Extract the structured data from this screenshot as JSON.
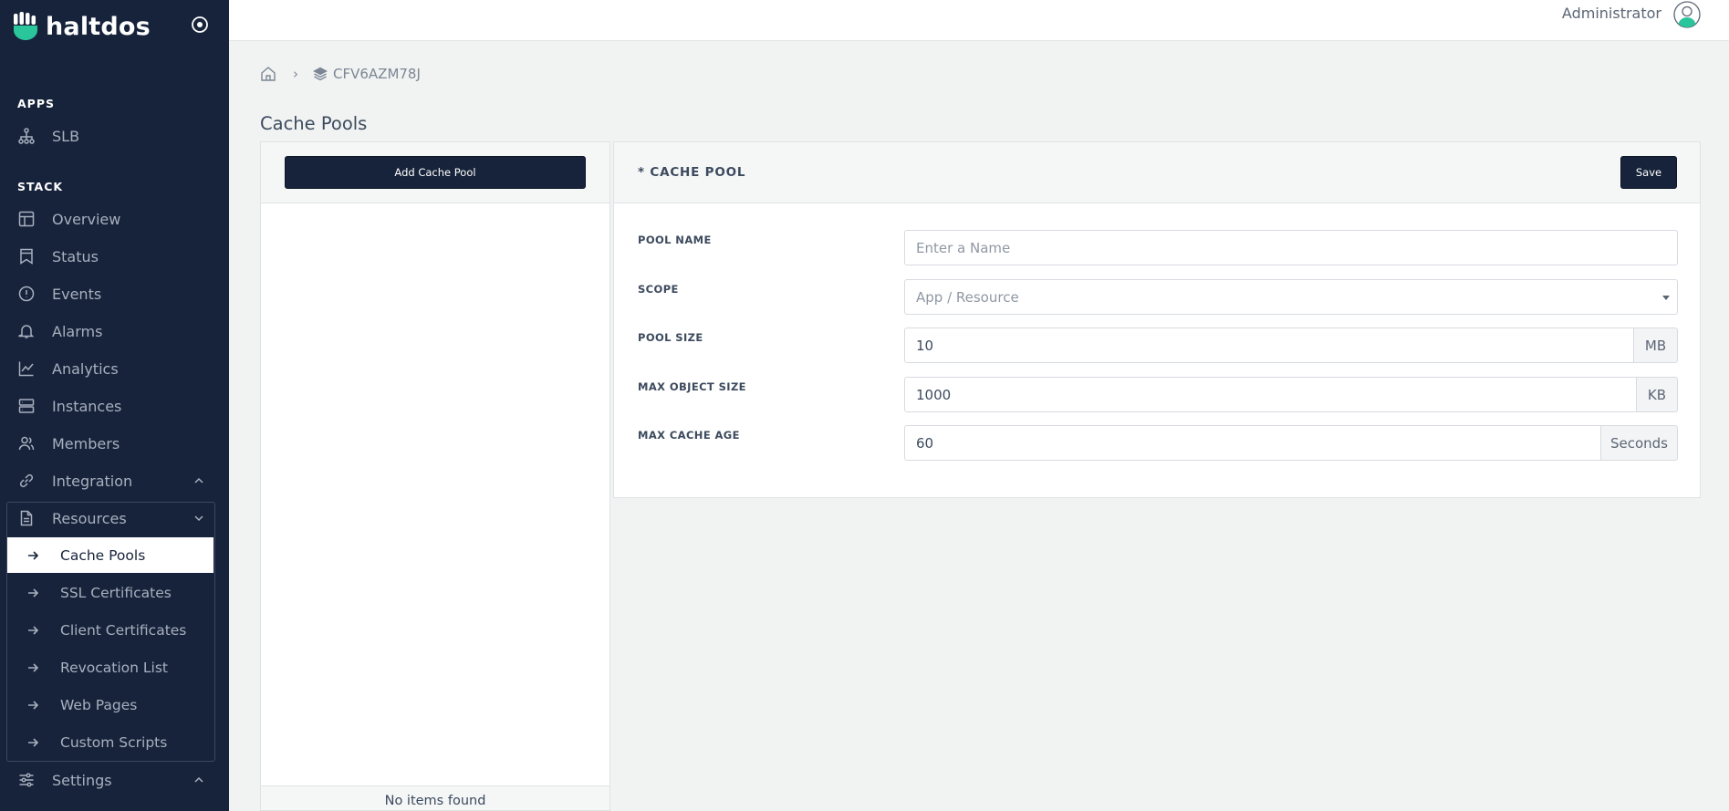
{
  "app": {
    "brand": "haltdos"
  },
  "sidebar": {
    "sections": {
      "apps": "APPS",
      "stack": "STACK"
    },
    "apps_items": [
      {
        "label": "SLB",
        "icon": "sitemap-icon"
      }
    ],
    "stack_items": [
      {
        "label": "Overview",
        "icon": "layout-icon"
      },
      {
        "label": "Status",
        "icon": "bookmark-icon"
      },
      {
        "label": "Events",
        "icon": "alert-circle-icon"
      },
      {
        "label": "Alarms",
        "icon": "bell-icon"
      },
      {
        "label": "Analytics",
        "icon": "line-chart-icon"
      },
      {
        "label": "Instances",
        "icon": "server-icon"
      },
      {
        "label": "Members",
        "icon": "users-icon"
      },
      {
        "label": "Integration",
        "icon": "link-icon"
      },
      {
        "label": "Resources",
        "icon": "file-icon"
      }
    ],
    "resources_sub": [
      {
        "label": "Cache Pools",
        "active": true
      },
      {
        "label": "SSL Certificates"
      },
      {
        "label": "Client Certificates"
      },
      {
        "label": "Revocation List"
      },
      {
        "label": "Web Pages"
      },
      {
        "label": "Custom Scripts"
      }
    ],
    "settings": {
      "label": "Settings",
      "icon": "sliders-icon"
    }
  },
  "topbar": {
    "user": "Administrator"
  },
  "breadcrumb": {
    "stack_id": "CFV6AZM78J"
  },
  "page": {
    "title": "Cache Pools"
  },
  "list": {
    "add_label": "Add Cache Pool",
    "empty_text": "No items found"
  },
  "form": {
    "title": "* CACHE POOL",
    "save_label": "Save",
    "pool_name": {
      "label": "POOL NAME",
      "placeholder": "Enter a Name",
      "value": ""
    },
    "scope": {
      "label": "SCOPE",
      "placeholder": "App / Resource"
    },
    "pool_size": {
      "label": "POOL SIZE",
      "value": "10",
      "unit": "MB"
    },
    "max_object_size": {
      "label": "MAX OBJECT SIZE",
      "value": "1000",
      "unit": "KB"
    },
    "max_cache_age": {
      "label": "MAX CACHE AGE",
      "value": "60",
      "unit": "Seconds"
    }
  },
  "colors": {
    "sidebar_bg": "#17233a",
    "accent": "#2bc59b",
    "page_bg": "#f1f3f2"
  }
}
